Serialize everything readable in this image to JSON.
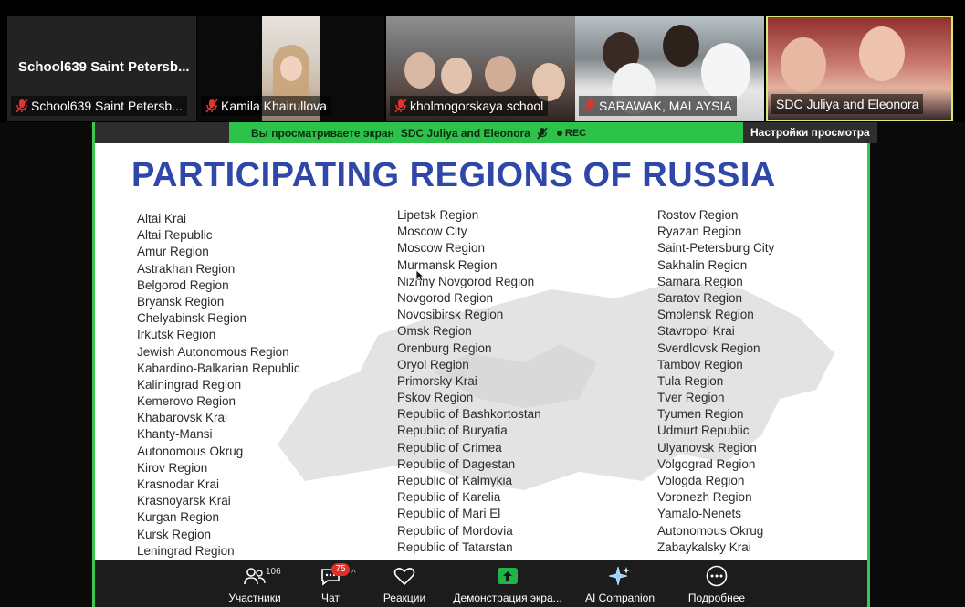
{
  "participants": [
    {
      "tile_title": "School639 Saint Petersb...",
      "name": "School639 Saint Petersb..."
    },
    {
      "name": "Kamila Khairullova"
    },
    {
      "name": "kholmogorskaya school"
    },
    {
      "name": "SARAWAK, MALAYSIA"
    },
    {
      "name": "SDC Juliya and Eleonora"
    }
  ],
  "share_bar": {
    "viewing_text": "Вы просматриваете экран",
    "presenter": "SDC Juliya and Eleonora",
    "rec_label": "REC",
    "settings_label": "Настройки просмотра"
  },
  "slide": {
    "title": "PARTICIPATING REGIONS OF RUSSIA",
    "column1": [
      "Altai Krai",
      "Altai Republic",
      "Amur Region",
      "Astrakhan Region",
      "Belgorod Region",
      "Bryansk Region",
      "Chelyabinsk Region",
      "Irkutsk Region",
      "Jewish Autonomous Region",
      "Kabardino-Balkarian Republic",
      "Kaliningrad Region",
      "Kemerovo Region",
      "Khabarovsk Krai",
      "Khanty-Mansi",
      "Autonomous Okrug",
      "Kirov Region",
      "Krasnodar Krai",
      "Krasnoyarsk Krai",
      "Kurgan Region",
      "Kursk Region",
      "Leningrad Region"
    ],
    "column2": [
      "Lipetsk Region",
      "Moscow City",
      "Moscow Region",
      "Murmansk Region",
      "Nizhny Novgorod Region",
      "Novgorod Region",
      "Novosibirsk Region",
      "Omsk Region",
      "Orenburg Region",
      "Oryol Region",
      "Primorsky Krai",
      "Pskov Region",
      "Republic of Bashkortostan",
      "Republic of Buryatia",
      "Republic of Crimea",
      "Republic of Dagestan",
      "Republic of Kalmykia",
      "Republic of Karelia",
      "Republic of Mari El",
      "Republic of Mordovia",
      "Republic of Tatarstan"
    ],
    "column3": [
      "Rostov Region",
      "Ryazan Region",
      "Saint-Petersburg City",
      "Sakhalin Region",
      "Samara Region",
      "Saratov Region",
      "Smolensk Region",
      "Stavropol Krai",
      "Sverdlovsk Region",
      "Tambov Region",
      "Tula Region",
      "Tver Region",
      "Tyumen Region",
      "Udmurt Republic",
      "Ulyanovsk Region",
      "Volgograd Region",
      "Vologda Region",
      "Voronezh Region",
      "Yamalo-Nenets",
      "Autonomous Okrug",
      "Zabaykalsky Krai"
    ]
  },
  "toolbar": {
    "participants_label": "Участники",
    "participants_count": "106",
    "chat_label": "Чат",
    "chat_badge": "75",
    "reactions_label": "Реакции",
    "share_label": "Демонстрация экра...",
    "ai_label": "AI Companion",
    "more_label": "Подробнее"
  },
  "colors": {
    "accent_green": "#2dc34a",
    "title_blue": "#2f47a8",
    "mute_red": "#e0342c",
    "share_green": "#1fb34a"
  }
}
